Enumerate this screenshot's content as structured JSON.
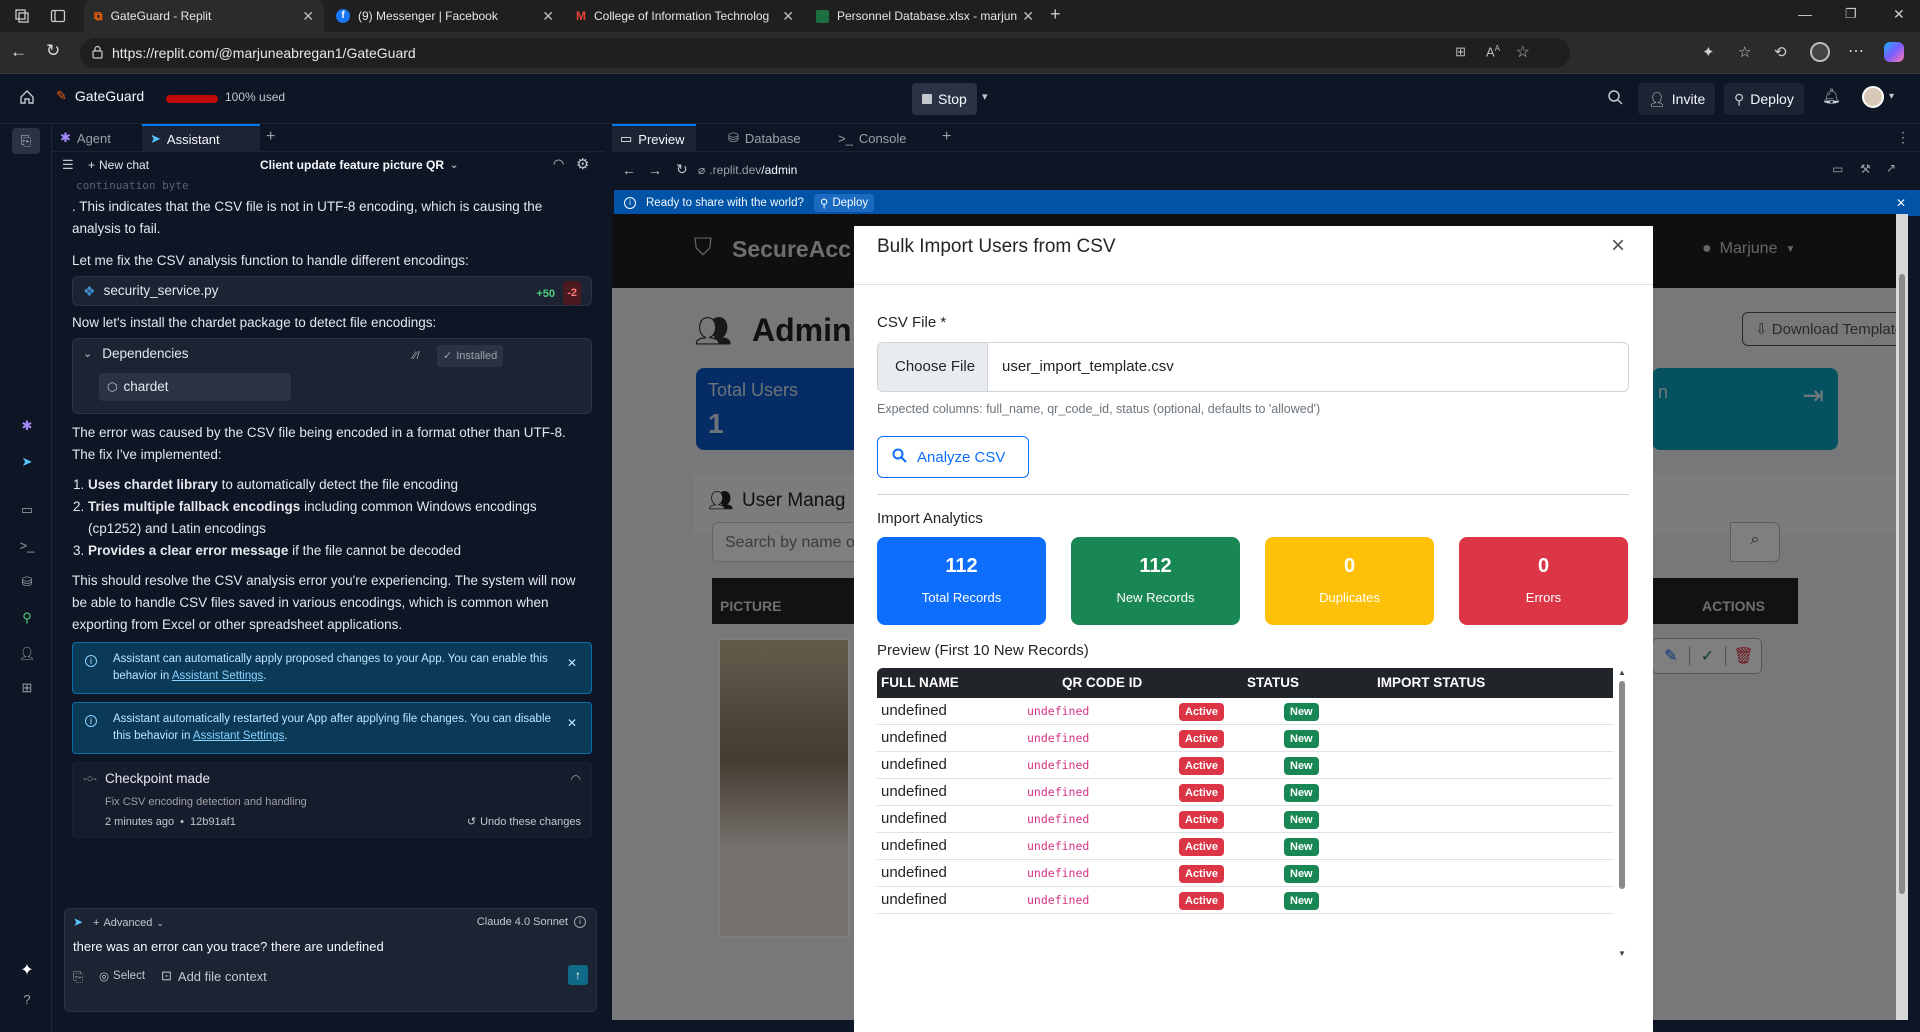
{
  "browser": {
    "tabs": [
      {
        "title": "GateGuard - Replit"
      },
      {
        "title": "(9) Messenger | Facebook"
      },
      {
        "title": "College of Information Technolog"
      },
      {
        "title": "Personnel Database.xlsx - marjun"
      }
    ],
    "url": "https://replit.com/@marjuneabregan1/GateGuard"
  },
  "replit": {
    "project": "GateGuard",
    "usage": "100% used",
    "stop_label": "Stop",
    "invite_label": "Invite",
    "deploy_label": "Deploy"
  },
  "assistant": {
    "tabs": {
      "agent": "Agent",
      "assistant": "Assistant"
    },
    "new_chat": "New chat",
    "thread_title": "Client update feature picture QR",
    "code_fragment": "continuation byte",
    "p1": ". This indicates that the CSV file is not in UTF-8 encoding, which is causing the analysis to fail.",
    "p2": "Let me fix the CSV analysis function to handle different encodings:",
    "file": {
      "name": "security_service.py",
      "added": "+50",
      "removed": "-2"
    },
    "p3": "Now let's install the chardet package to detect file encodings:",
    "deps": {
      "title": "Dependencies",
      "status": "Installed",
      "package": "chardet"
    },
    "p4": "The error was caused by the CSV file being encoded in a format other than UTF-8. The fix I've implemented:",
    "list": [
      {
        "bold": "Uses chardet library",
        "rest": " to automatically detect the file encoding"
      },
      {
        "bold": "Tries multiple fallback encodings",
        "rest": " including common Windows encodings (cp1252) and Latin encodings"
      },
      {
        "bold": "Provides a clear error message",
        "rest": " if the file cannot be decoded"
      }
    ],
    "p5": "This should resolve the CSV analysis error you're experiencing. The system will now be able to handle CSV files saved in various encodings, which is common when exporting from Excel or other spreadsheet applications.",
    "info1": {
      "text": "Assistant can automatically apply proposed changes to your App. You can enable this behavior in ",
      "link": "Assistant Settings",
      "end": "."
    },
    "info2": {
      "text": "Assistant automatically restarted your App after applying file changes. You can disable this behavior in ",
      "link": "Assistant Settings",
      "end": "."
    },
    "checkpoint": {
      "title": "Checkpoint made",
      "desc": "Fix CSV encoding detection and handling",
      "time": "2 minutes ago",
      "hash": "12b91af1",
      "undo": "Undo these changes"
    },
    "composer": {
      "mode": "Advanced",
      "model": "Claude 4.0 Sonnet",
      "input": "there was an error can you trace? there are undefined",
      "select": "Select",
      "add_context": "Add file context"
    }
  },
  "preview": {
    "tabs": {
      "preview": "Preview",
      "database": "Database",
      "console": "Console"
    },
    "url_prefix": ".replit.dev",
    "url_path": "/admin",
    "banner": {
      "text": "Ready to share with the world?",
      "deploy": "Deploy"
    }
  },
  "app": {
    "brand": "SecureAcc",
    "user": "Marjune",
    "admin_title": "Admin",
    "download": "Download Template",
    "total_users_label": "Total Users",
    "total_users_value": "1",
    "user_mgmt": "User Manag",
    "search_placeholder": "Search by name o",
    "col_picture": "PICTURE",
    "col_actions": "ACTIONS",
    "card_fragment": "n"
  },
  "modal": {
    "title": "Bulk Import Users from CSV",
    "csv_label": "CSV File *",
    "choose_file": "Choose File",
    "file_name": "user_import_template.csv",
    "help": "Expected columns: full_name, qr_code_id, status (optional, defaults to 'allowed')",
    "analyze": "Analyze CSV",
    "analytics_title": "Import Analytics",
    "stats": [
      {
        "value": "112",
        "label": "Total Records",
        "color": "#0d6efd"
      },
      {
        "value": "112",
        "label": "New Records",
        "color": "#198754"
      },
      {
        "value": "0",
        "label": "Duplicates",
        "color": "#ffc107"
      },
      {
        "value": "0",
        "label": "Errors",
        "color": "#dc3545"
      }
    ],
    "preview_title": "Preview (First 10 New Records)",
    "columns": [
      "FULL NAME",
      "QR CODE ID",
      "STATUS",
      "IMPORT STATUS"
    ],
    "rows": [
      {
        "name": "undefined",
        "qr": "undefined",
        "status": "Active",
        "import": "New"
      },
      {
        "name": "undefined",
        "qr": "undefined",
        "status": "Active",
        "import": "New"
      },
      {
        "name": "undefined",
        "qr": "undefined",
        "status": "Active",
        "import": "New"
      },
      {
        "name": "undefined",
        "qr": "undefined",
        "status": "Active",
        "import": "New"
      },
      {
        "name": "undefined",
        "qr": "undefined",
        "status": "Active",
        "import": "New"
      },
      {
        "name": "undefined",
        "qr": "undefined",
        "status": "Active",
        "import": "New"
      },
      {
        "name": "undefined",
        "qr": "undefined",
        "status": "Active",
        "import": "New"
      },
      {
        "name": "undefined",
        "qr": "undefined",
        "status": "Active",
        "import": "New"
      }
    ]
  }
}
